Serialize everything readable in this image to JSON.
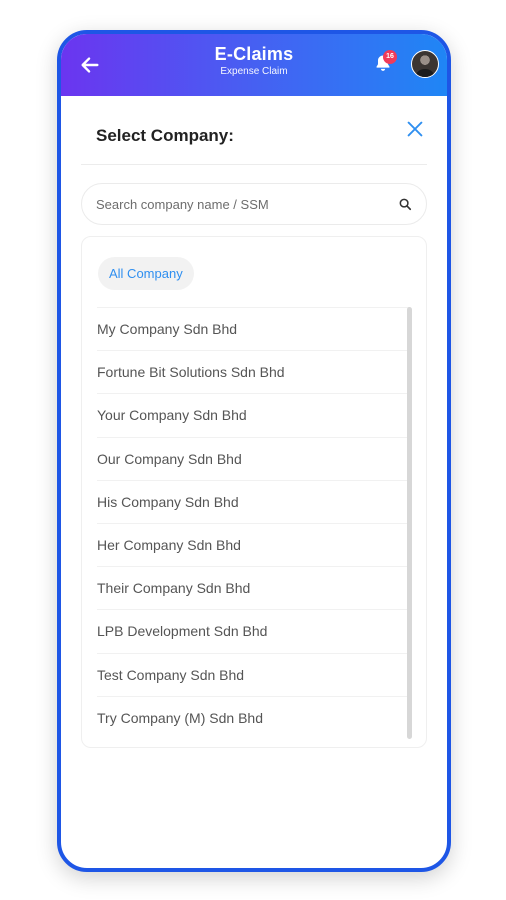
{
  "app_bar": {
    "title": "E-Claims",
    "subtitle": "Expense Claim",
    "notification_count": "16",
    "back_icon": "arrow-left-icon",
    "bell_icon": "bell-icon",
    "avatar_icon": "user-avatar"
  },
  "sheet": {
    "title": "Select Company:",
    "close_icon": "close-icon"
  },
  "search": {
    "placeholder": "Search company name / SSM",
    "value": "",
    "icon": "search-icon"
  },
  "filter": {
    "chip_label": "All Company"
  },
  "companies": [
    "My Company Sdn Bhd",
    "Fortune Bit Solutions Sdn Bhd",
    "Your Company Sdn Bhd",
    "Our Company Sdn Bhd",
    "His Company Sdn Bhd",
    "Her Company Sdn Bhd",
    "Their Company Sdn Bhd",
    "LPB Development Sdn Bhd",
    "Test Company Sdn Bhd",
    "Try Company (M) Sdn Bhd"
  ],
  "colors": {
    "frame": "#1e56e6",
    "header_start": "#6b35f0",
    "header_end": "#1f86f5",
    "accent": "#2f8ff0",
    "badge": "#ef3b5a"
  }
}
